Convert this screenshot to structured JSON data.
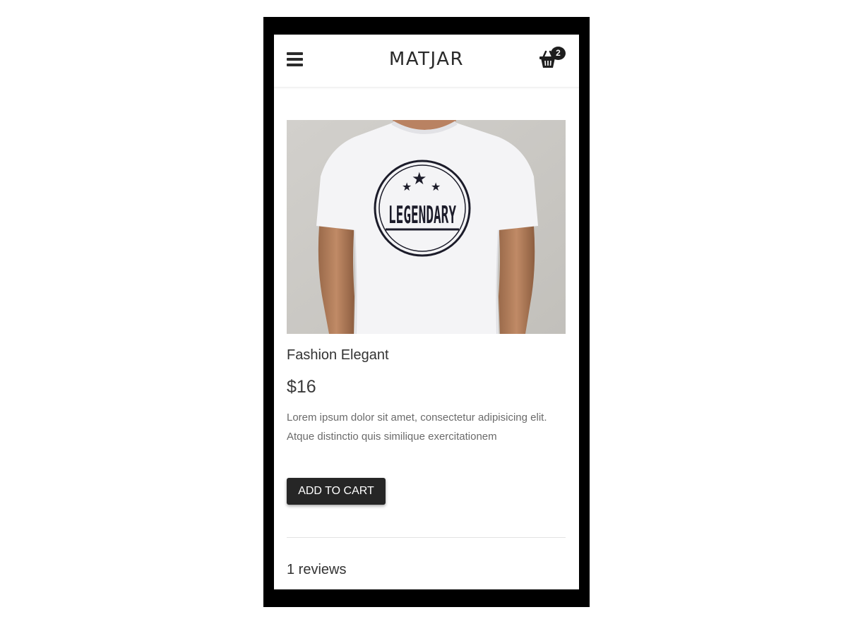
{
  "header": {
    "brand": "MATJAR",
    "menu_icon": "hamburger-menu-icon",
    "cart_icon": "shopping-basket-icon",
    "cart_count": "2"
  },
  "product": {
    "image_alt": "White t-shirt with Legendary print",
    "image_print_text": "LEGENDARY",
    "title": "Fashion Elegant",
    "price": "$16",
    "description": "Lorem ipsum dolor sit amet, consectetur adipisicing elit. Atque distinctio quis similique exercitationem",
    "add_to_cart_label": "ADD TO CART"
  },
  "reviews": {
    "count_label": "1 reviews"
  },
  "colors": {
    "button_bg": "#262626",
    "text_primary": "#333333",
    "text_muted": "#6b6b6b"
  }
}
